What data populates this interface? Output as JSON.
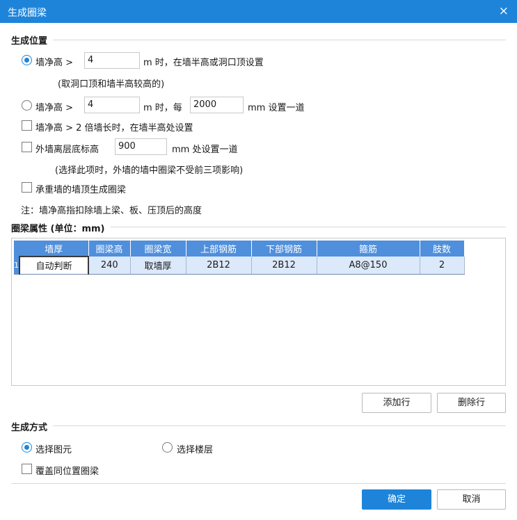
{
  "window": {
    "title": "生成圈梁",
    "close_glyph": "×"
  },
  "position_section": {
    "title": "生成位置",
    "opt1": {
      "prefix": "墙净高 >",
      "value": "4",
      "suffix": "m 时，在墙半高或洞口顶设置",
      "note": "(取洞口顶和墙半高较高的)"
    },
    "opt2": {
      "prefix": "墙净高 >",
      "value": "4",
      "mid": "m 时，每",
      "value2": "2000",
      "suffix": "mm 设置一道"
    },
    "opt3": {
      "label": "墙净高 > 2 倍墙长时，在墙半高处设置"
    },
    "opt4": {
      "prefix": "外墙离层底标高",
      "value": "900",
      "suffix": "mm 处设置一道",
      "note": "(选择此项时，外墙的墙中圈梁不受前三项影响)"
    },
    "opt5": {
      "label": "承重墙的墙顶生成圈梁"
    },
    "note": "注：墙净高指扣除墙上梁、板、压顶后的高度"
  },
  "attr_section": {
    "title": "圈梁属性 (单位：mm)",
    "columns": [
      "墙厚",
      "圈梁高",
      "圈梁宽",
      "上部钢筋",
      "下部钢筋",
      "箍筋",
      "肢数"
    ],
    "rows": [
      {
        "num": "1",
        "cells": [
          "自动判断",
          "240",
          "取墙厚",
          "2B12",
          "2B12",
          "A8@150",
          "2"
        ]
      }
    ],
    "add_row": "添加行",
    "delete_row": "删除行"
  },
  "method_section": {
    "title": "生成方式",
    "select_element": "选择图元",
    "select_floor": "选择楼层",
    "overwrite": "覆盖同位置圈梁"
  },
  "footer": {
    "ok": "确定",
    "cancel": "取消"
  },
  "colors": {
    "accent": "#1e84d9",
    "header": "#4f8fdc",
    "row": "#dce9fb"
  }
}
